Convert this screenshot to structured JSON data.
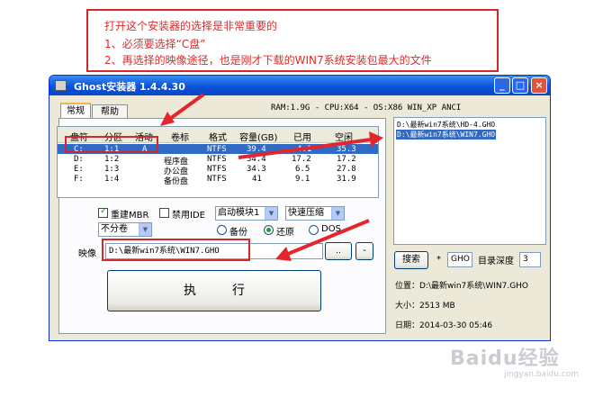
{
  "note": {
    "line1": "打开这个安装器的选择是非常重要的",
    "line2": "1、必须要选择“C盘”",
    "line3": "2、再选择的映像途径，也是刚才下载的WIN7系统安装包最大的文件"
  },
  "window": {
    "title": "Ghost安装器 1.4.4.30",
    "minimize": "_",
    "maximize": "□",
    "close": "×"
  },
  "tabs": [
    {
      "label": "常规",
      "active": true
    },
    {
      "label": "帮助",
      "active": false
    }
  ],
  "sysinfo": "RAM:1.9G - CPU:X64 - OS:X86 WIN_XP ANCI",
  "partitions": {
    "columns": [
      "盘符",
      "分区",
      "活动",
      "卷标",
      "格式",
      "容量(GB)",
      "已用",
      "空闲"
    ],
    "rows": [
      [
        "C:",
        "1:1",
        "A",
        "",
        "NTFS",
        "39.4",
        "4.1",
        "35.3"
      ],
      [
        "D:",
        "1:2",
        "",
        "程序盘",
        "NTFS",
        "34.4",
        "17.2",
        "17.2"
      ],
      [
        "E:",
        "1:3",
        "",
        "办公盘",
        "NTFS",
        "34.3",
        "6.5",
        "27.8"
      ],
      [
        "F:",
        "1:4",
        "",
        "备份盘",
        "NTFS",
        "41",
        "9.1",
        "31.9"
      ]
    ]
  },
  "options": {
    "rebuild_mbr": "重建MBR",
    "disable_ide": "禁用IDE",
    "boot_mode": "启动模块1",
    "compress": "快速压缩",
    "split": "不分卷",
    "backup": "备份",
    "restore": "还原",
    "dos": "DOS"
  },
  "image": {
    "label": "映像",
    "path": "D:\\最新win7系统\\WIN7.GHO",
    "browse": "..",
    "minus": "-"
  },
  "execute_label": "执行",
  "files": [
    {
      "text": "D:\\最新win7系统\\HD-4.GHO",
      "selected": false
    },
    {
      "text": "D:\\最新win7系统\\WIN7.GHO",
      "selected": true
    }
  ],
  "search": {
    "button": "搜索",
    "star": "*",
    "ext": "GHO",
    "depth_label": "目录深度",
    "depth": "3"
  },
  "info": {
    "location": "位置：D:\\最新win7系统\\WIN7.GHO",
    "size": "大小：2513 MB",
    "date": "日期：2014-03-30    05:46"
  },
  "watermark": "Baidu经验",
  "watermark_sub": "jingyan.baidu.com"
}
